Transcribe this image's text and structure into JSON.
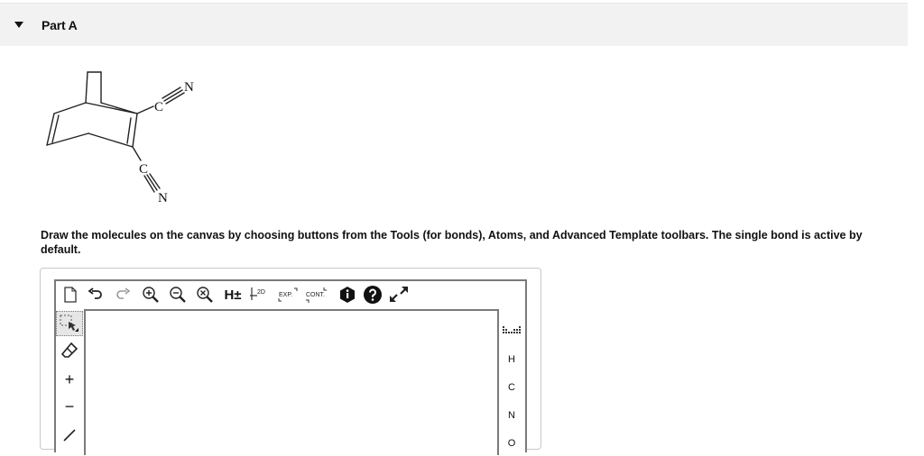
{
  "part": {
    "title": "Part A"
  },
  "molecule": {
    "atoms": [
      "C",
      "N",
      "C",
      "N"
    ]
  },
  "instructions": "Draw the molecules on the canvas by choosing buttons from the Tools (for bonds), Atoms, and Advanced Template toolbars. The single bond is active by default.",
  "editor": {
    "toolbar_top": {
      "hydrogen_label": "H±",
      "clean2d_label": "2D",
      "expand_label": "EXP.",
      "contract_label": "CONT."
    },
    "toolbar_left": {
      "plus_label": "+",
      "minus_label": "−"
    },
    "atoms": [
      "H",
      "C",
      "N",
      "O"
    ]
  },
  "colors": {
    "header_bg": "#f2f2f2",
    "frame_border": "#7a7a7a",
    "text": "#111111"
  }
}
